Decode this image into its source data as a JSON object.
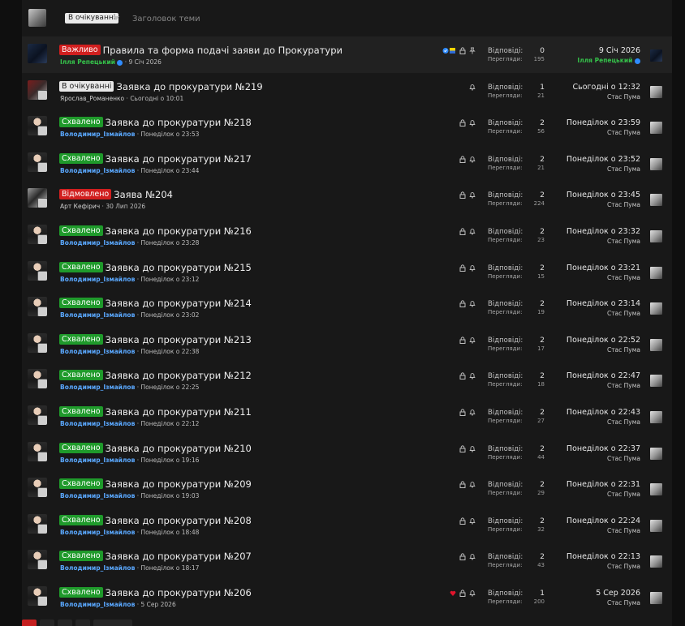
{
  "toolbar": {
    "prefix_filter": "В очікуванні",
    "title_placeholder": "Заголовок теми"
  },
  "labels": {
    "replies": "Відповіді:",
    "views": "Перегляди:"
  },
  "prefixes": {
    "important": {
      "text": "Важливо",
      "bg": "#d11f1f",
      "fg": "#ffffff"
    },
    "pending": {
      "text": "В очікуванні",
      "bg": "#e9e9e9",
      "fg": "#222222"
    },
    "approved": {
      "text": "Схвалено",
      "bg": "#1f9a2b",
      "fg": "#ffffff"
    },
    "rejected": {
      "text": "Відмовлено",
      "bg": "#d11f1f",
      "fg": "#ffffff"
    }
  },
  "threads": [
    {
      "prefix": "Важливо",
      "prefix_type": "important",
      "title": "Правила та форма подачі заяви до Прокуратури",
      "author": "Ілля Репецький",
      "author_style": "green",
      "verified": true,
      "date": "9 Січ 2026",
      "replies": "0",
      "views": "195",
      "last_date": "9 Січ 2026",
      "last_user": "Ілля Репецький",
      "last_user_style": "green",
      "icons": [
        "badge-icons",
        "lock-icon",
        "pin-icon"
      ],
      "sticky": true
    },
    {
      "prefix": "В очікуванні",
      "prefix_type": "pending",
      "title": "Заявка до прокуратури №219",
      "author": "Ярослав_Романенко",
      "author_style": "plain",
      "date": "Сьогодні о 10:01",
      "replies": "1",
      "views": "21",
      "last_date": "Сьогодні о 12:32",
      "last_user": "Стас Пума",
      "icons": [
        "bell-icon"
      ]
    },
    {
      "prefix": "Схвалено",
      "prefix_type": "approved",
      "title": "Заявка до прокуратури №218",
      "author": "Володимир_Ізмайлов",
      "author_style": "blue",
      "date": "Понеділок о 23:53",
      "replies": "2",
      "views": "56",
      "last_date": "Понеділок о 23:59",
      "last_user": "Стас Пума",
      "icons": [
        "lock-icon",
        "bell-icon"
      ]
    },
    {
      "prefix": "Схвалено",
      "prefix_type": "approved",
      "title": "Заявка до прокуратури №217",
      "author": "Володимир_Ізмайлов",
      "author_style": "blue",
      "date": "Понеділок о 23:44",
      "replies": "2",
      "views": "21",
      "last_date": "Понеділок о 23:52",
      "last_user": "Стас Пума",
      "icons": [
        "lock-icon",
        "bell-icon"
      ]
    },
    {
      "prefix": "Відмовлено",
      "prefix_type": "rejected",
      "title": "Заява №204",
      "author": "Арт Кефірич",
      "author_style": "plain",
      "date": "30 Лип 2026",
      "replies": "2",
      "views": "224",
      "last_date": "Понеділок о 23:45",
      "last_user": "Стас Пума",
      "icons": [
        "lock-icon",
        "bell-icon"
      ]
    },
    {
      "prefix": "Схвалено",
      "prefix_type": "approved",
      "title": "Заявка до прокуратури №216",
      "author": "Володимир_Ізмайлов",
      "author_style": "blue",
      "date": "Понеділок о 23:28",
      "replies": "2",
      "views": "23",
      "last_date": "Понеділок о 23:32",
      "last_user": "Стас Пума",
      "icons": [
        "lock-icon",
        "bell-icon"
      ]
    },
    {
      "prefix": "Схвалено",
      "prefix_type": "approved",
      "title": "Заявка до прокуратури №215",
      "author": "Володимир_Ізмайлов",
      "author_style": "blue",
      "date": "Понеділок о 23:12",
      "replies": "2",
      "views": "15",
      "last_date": "Понеділок о 23:21",
      "last_user": "Стас Пума",
      "icons": [
        "lock-icon",
        "bell-icon"
      ]
    },
    {
      "prefix": "Схвалено",
      "prefix_type": "approved",
      "title": "Заявка до прокуратури №214",
      "author": "Володимир_Ізмайлов",
      "author_style": "blue",
      "date": "Понеділок о 23:02",
      "replies": "2",
      "views": "19",
      "last_date": "Понеділок о 23:14",
      "last_user": "Стас Пума",
      "icons": [
        "lock-icon",
        "bell-icon"
      ]
    },
    {
      "prefix": "Схвалено",
      "prefix_type": "approved",
      "title": "Заявка до прокуратури №213",
      "author": "Володимир_Ізмайлов",
      "author_style": "blue",
      "date": "Понеділок о 22:38",
      "replies": "2",
      "views": "17",
      "last_date": "Понеділок о 22:52",
      "last_user": "Стас Пума",
      "icons": [
        "lock-icon",
        "bell-icon"
      ]
    },
    {
      "prefix": "Схвалено",
      "prefix_type": "approved",
      "title": "Заявка до прокуратури №212",
      "author": "Володимир_Ізмайлов",
      "author_style": "blue",
      "date": "Понеділок о 22:25",
      "replies": "2",
      "views": "18",
      "last_date": "Понеділок о 22:47",
      "last_user": "Стас Пума",
      "icons": [
        "lock-icon",
        "bell-icon"
      ]
    },
    {
      "prefix": "Схвалено",
      "prefix_type": "approved",
      "title": "Заявка до прокуратури №211",
      "author": "Володимир_Ізмайлов",
      "author_style": "blue",
      "date": "Понеділок о 22:12",
      "replies": "2",
      "views": "27",
      "last_date": "Понеділок о 22:43",
      "last_user": "Стас Пума",
      "icons": [
        "lock-icon",
        "bell-icon"
      ]
    },
    {
      "prefix": "Схвалено",
      "prefix_type": "approved",
      "title": "Заявка до прокуратури №210",
      "author": "Володимир_Ізмайлов",
      "author_style": "blue",
      "date": "Понеділок о 19:16",
      "replies": "2",
      "views": "44",
      "last_date": "Понеділок о 22:37",
      "last_user": "Стас Пума",
      "icons": [
        "lock-icon",
        "bell-icon"
      ]
    },
    {
      "prefix": "Схвалено",
      "prefix_type": "approved",
      "title": "Заявка до прокуратури №209",
      "author": "Володимир_Ізмайлов",
      "author_style": "blue",
      "date": "Понеділок о 19:03",
      "replies": "2",
      "views": "29",
      "last_date": "Понеділок о 22:31",
      "last_user": "Стас Пума",
      "icons": [
        "lock-icon",
        "bell-icon"
      ]
    },
    {
      "prefix": "Схвалено",
      "prefix_type": "approved",
      "title": "Заявка до прокуратури №208",
      "author": "Володимир_Ізмайлов",
      "author_style": "blue",
      "date": "Понеділок о 18:48",
      "replies": "2",
      "views": "32",
      "last_date": "Понеділок о 22:24",
      "last_user": "Стас Пума",
      "icons": [
        "lock-icon",
        "bell-icon"
      ]
    },
    {
      "prefix": "Схвалено",
      "prefix_type": "approved",
      "title": "Заявка до прокуратури №207",
      "author": "Володимир_Ізмайлов",
      "author_style": "blue",
      "date": "Понеділок о 18:17",
      "replies": "2",
      "views": "43",
      "last_date": "Понеділок о 22:13",
      "last_user": "Стас Пума",
      "icons": [
        "lock-icon",
        "bell-icon"
      ]
    },
    {
      "prefix": "Схвалено",
      "prefix_type": "approved",
      "title": "Заявка до прокуратури №206",
      "author": "Володимир_Ізмайлов",
      "author_style": "blue",
      "date": "5 Сер 2026",
      "replies": "1",
      "views": "200",
      "last_date": "5 Сер 2026",
      "last_user": "Стас Пума",
      "icons": [
        "heart-icon",
        "lock-icon",
        "bell-icon"
      ]
    }
  ],
  "colors": {
    "page_bg": "#0f0f0f",
    "panel_bg": "#181818",
    "sticky_bg": "#212121",
    "pager_active": "#c51f1f"
  }
}
